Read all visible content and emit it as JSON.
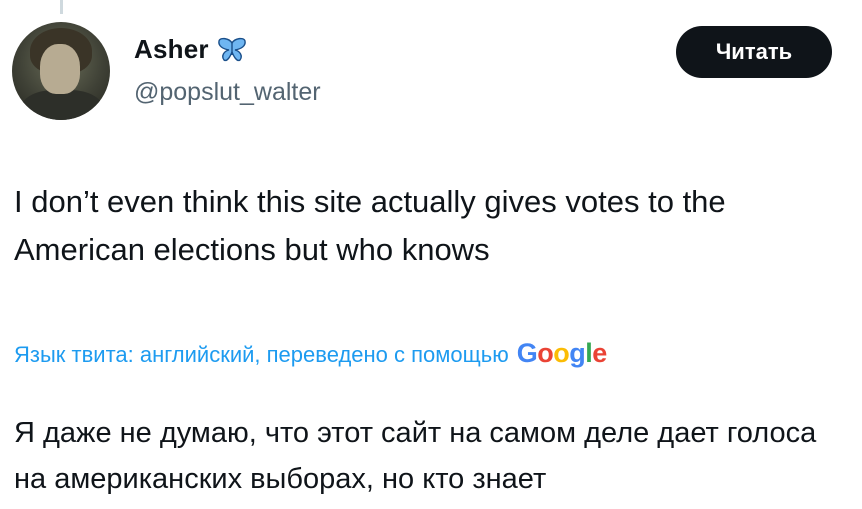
{
  "author": {
    "name": "Asher",
    "handle": "@popslut_walter",
    "badge_icon": "butterfly-icon"
  },
  "follow_button": {
    "label": "Читать"
  },
  "tweet": {
    "text": "I don’t even think this site actually gives votes to the American elections but who knows"
  },
  "translation": {
    "note": "Язык твита: английский, переведено с помощью",
    "provider": "Google",
    "text": "Я даже не думаю, что этот сайт на самом деле дает голоса на американских выборах, но кто знает"
  },
  "colors": {
    "link_blue": "#1d9bf0",
    "text_primary": "#0f1419",
    "text_secondary": "#536471",
    "button_bg": "#0f1419"
  }
}
